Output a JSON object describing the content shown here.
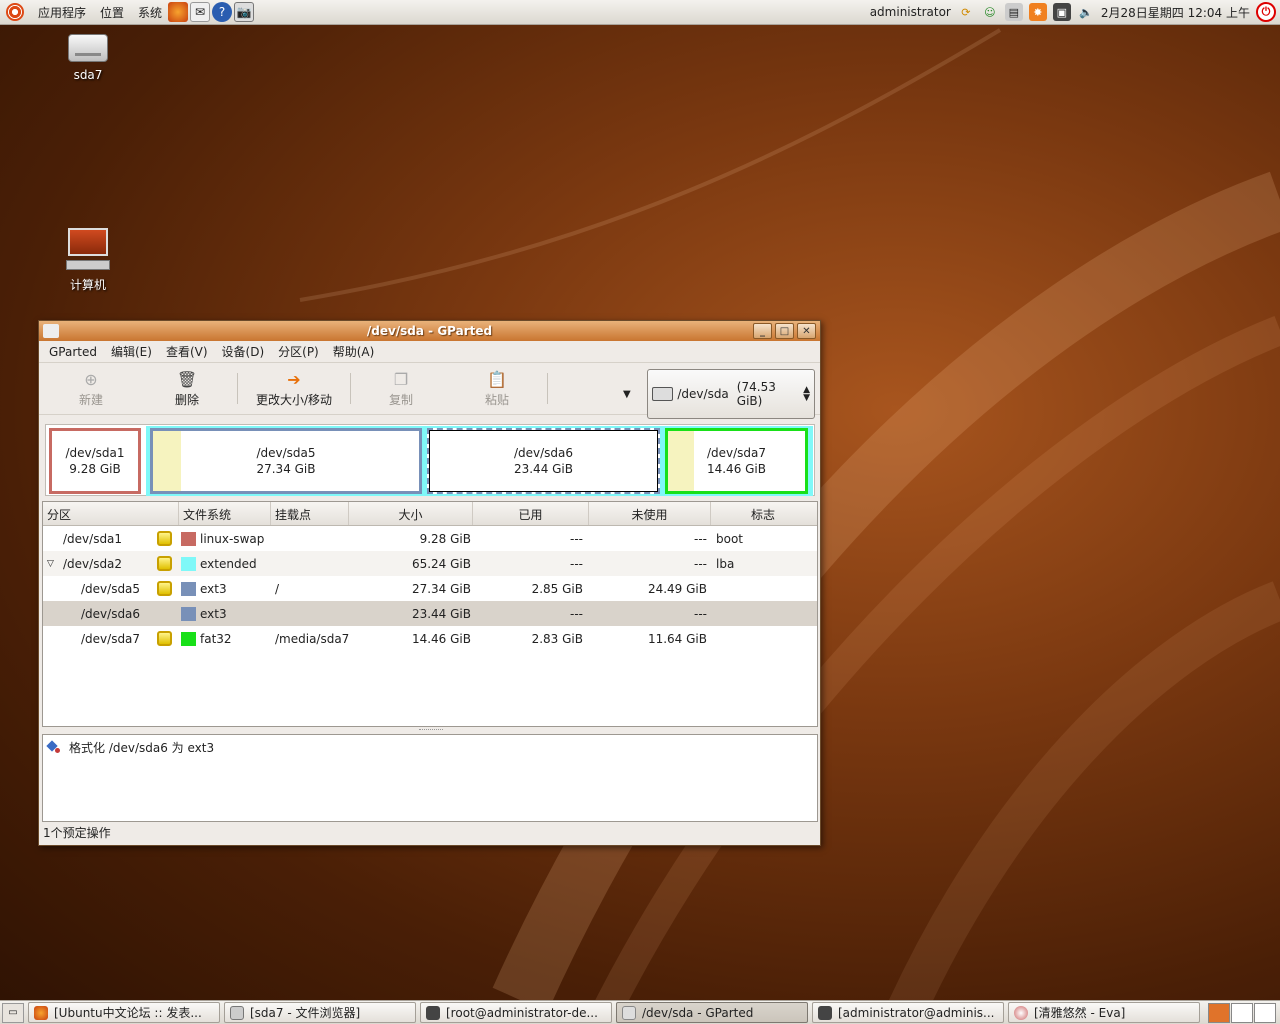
{
  "top_panel": {
    "menus": [
      "应用程序",
      "位置",
      "系统"
    ],
    "user": "administrator",
    "datetime": "2月28日星期四 12:04 上午"
  },
  "desktop": {
    "icons": [
      {
        "label": "sda7"
      },
      {
        "label": "计算机"
      }
    ]
  },
  "window": {
    "title": "/dev/sda - GParted",
    "menu": [
      "GParted",
      "编辑(E)",
      "查看(V)",
      "设备(D)",
      "分区(P)",
      "帮助(A)"
    ],
    "toolbar": {
      "new": "新建",
      "delete": "删除",
      "resize": "更改大小/移动",
      "copy": "复制",
      "paste": "粘贴"
    },
    "device": {
      "name": "/dev/sda",
      "size": "(74.53 GiB)"
    },
    "partition_map": [
      {
        "name": "/dev/sda1",
        "size": "9.28 GiB"
      },
      {
        "name": "/dev/sda5",
        "size": "27.34 GiB"
      },
      {
        "name": "/dev/sda6",
        "size": "23.44 GiB"
      },
      {
        "name": "/dev/sda7",
        "size": "14.46 GiB"
      }
    ],
    "table": {
      "headers": [
        "分区",
        "文件系统",
        "挂载点",
        "大小",
        "已用",
        "未使用",
        "标志"
      ],
      "rows": [
        {
          "partition": "/dev/sda1",
          "fs": "linux-swap",
          "color": "#c76a62",
          "mount": "",
          "size": "9.28 GiB",
          "used": "---",
          "unused": "---",
          "flags": "boot"
        },
        {
          "partition": "/dev/sda2",
          "fs": "extended",
          "color": "#7ff8f8",
          "mount": "",
          "size": "65.24 GiB",
          "used": "---",
          "unused": "---",
          "flags": "lba"
        },
        {
          "partition": "/dev/sda5",
          "fs": "ext3",
          "color": "#7890b8",
          "mount": "/",
          "size": "27.34 GiB",
          "used": "2.85 GiB",
          "unused": "24.49 GiB",
          "flags": ""
        },
        {
          "partition": "/dev/sda6",
          "fs": "ext3",
          "color": "#7890b8",
          "mount": "",
          "size": "23.44 GiB",
          "used": "---",
          "unused": "---",
          "flags": ""
        },
        {
          "partition": "/dev/sda7",
          "fs": "fat32",
          "color": "#18e018",
          "mount": "/media/sda7",
          "size": "14.46 GiB",
          "used": "2.83 GiB",
          "unused": "11.64 GiB",
          "flags": ""
        }
      ]
    },
    "operations": [
      "格式化 /dev/sda6 为 ext3"
    ],
    "status": "1个预定操作"
  },
  "taskbar": {
    "tasks": [
      "[Ubuntu中文论坛 :: 发表...",
      "[sda7 - 文件浏览器]",
      "[root@administrator-de...",
      "/dev/sda - GParted",
      "[administrator@adminis...",
      "[清雅悠然 - Eva]"
    ]
  }
}
